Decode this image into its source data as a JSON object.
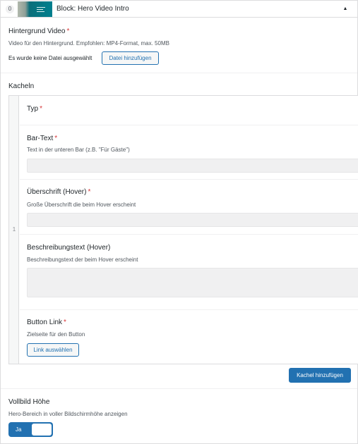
{
  "block": {
    "index": "0",
    "title": "Block: Hero Video Intro",
    "toggle_icon": "triangle-up-icon"
  },
  "hero_video": {
    "label": "Hintergrund Video",
    "required": "*",
    "description": "Video für den Hintergrund. Empfohlen: MP4-Format, max. 50MB",
    "no_file_text": "Es wurde keine Datei ausgewählt",
    "add_file_button": "Datei hinzufügen"
  },
  "tiles": {
    "label": "Kacheln",
    "row_number": "1",
    "type": {
      "label": "Typ",
      "required": "*"
    },
    "bar_text": {
      "label": "Bar-Text",
      "required": "*",
      "description": "Text in der unteren Bar (z.B. \"Für Gäste\")",
      "value": ""
    },
    "heading_hover": {
      "label": "Überschrift (Hover)",
      "required": "*",
      "description": "Große Überschrift die beim Hover erscheint",
      "value": ""
    },
    "description_hover": {
      "label": "Beschreibungstext (Hover)",
      "description": "Beschreibungstext der beim Hover erscheint",
      "value": ""
    },
    "button_link": {
      "label": "Button Link",
      "required": "*",
      "description": "Zielseite für den Button",
      "select_button": "Link auswählen"
    },
    "add_tile_button": "Kachel hinzufügen"
  },
  "fullscreen": {
    "label": "Vollbild Höhe",
    "description": "Hero-Bereich in voller Bildschirmhöhe anzeigen",
    "toggle_label": "Ja",
    "toggle_on": true
  },
  "colors": {
    "accent": "#2271b1",
    "required": "#d63638",
    "border": "#dcdcde",
    "input_bg": "#f0f0f1"
  }
}
